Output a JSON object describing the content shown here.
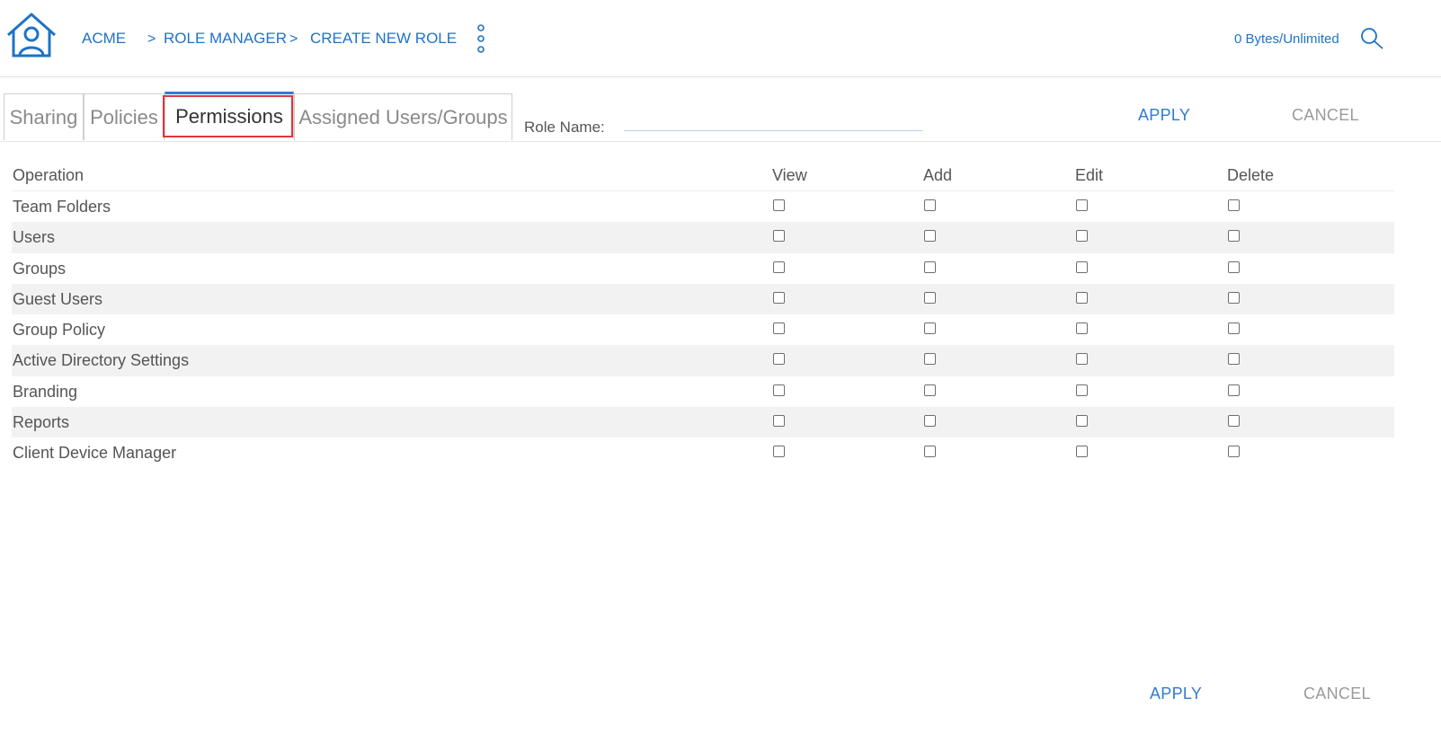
{
  "breadcrumb": {
    "root": "ACME",
    "separator": ">",
    "items": [
      "ROLE MANAGER",
      "CREATE NEW ROLE"
    ]
  },
  "storage_text": "0 Bytes/Unlimited",
  "icons": {
    "home": "home-user-icon",
    "more": "vertical-dots-icon",
    "search": "search-icon"
  },
  "tabs": [
    {
      "label": "Sharing",
      "active": false
    },
    {
      "label": "Policies",
      "active": false
    },
    {
      "label": "Permissions",
      "active": true
    },
    {
      "label": "Assigned Users/Groups",
      "active": false
    }
  ],
  "role_name": {
    "label": "Role Name:",
    "value": ""
  },
  "actions": {
    "apply": "APPLY",
    "cancel": "CANCEL"
  },
  "table": {
    "columns": [
      "Operation",
      "View",
      "Add",
      "Edit",
      "Delete"
    ],
    "rows": [
      {
        "operation": "Team Folders",
        "view": false,
        "add": false,
        "edit": false,
        "delete": false
      },
      {
        "operation": "Users",
        "view": false,
        "add": false,
        "edit": false,
        "delete": false
      },
      {
        "operation": "Groups",
        "view": false,
        "add": false,
        "edit": false,
        "delete": false
      },
      {
        "operation": "Guest Users",
        "view": false,
        "add": false,
        "edit": false,
        "delete": false
      },
      {
        "operation": "Group Policy",
        "view": false,
        "add": false,
        "edit": false,
        "delete": false
      },
      {
        "operation": "Active Directory Settings",
        "view": false,
        "add": false,
        "edit": false,
        "delete": false
      },
      {
        "operation": "Branding",
        "view": false,
        "add": false,
        "edit": false,
        "delete": false
      },
      {
        "operation": "Reports",
        "view": false,
        "add": false,
        "edit": false,
        "delete": false
      },
      {
        "operation": "Client Device Manager",
        "view": false,
        "add": false,
        "edit": false,
        "delete": false
      }
    ]
  },
  "colors": {
    "accent": "#2f7bd1",
    "link": "#1e73c6",
    "highlight": "#e3343a",
    "row_alt": "#f2f2f2"
  }
}
